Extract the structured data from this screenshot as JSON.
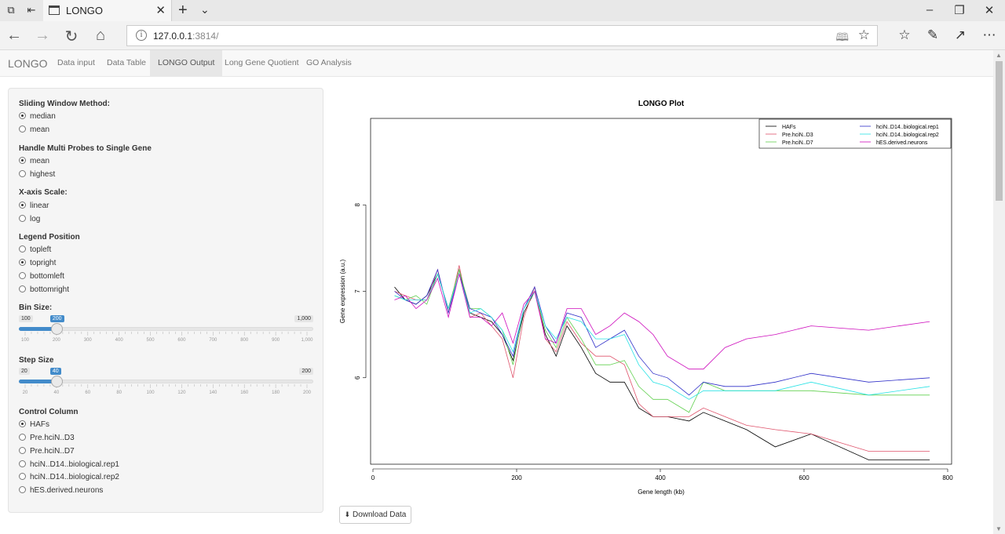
{
  "browser": {
    "tab_title": "LONGO",
    "url_host": "127.0.0.1",
    "url_rest": ":3814/"
  },
  "app": {
    "brand": "LONGO",
    "tabs": [
      "Data input",
      "Data Table",
      "LONGO Output",
      "Long Gene Quotient",
      "GO Analysis"
    ],
    "active_tab": "LONGO Output"
  },
  "sidebar": {
    "sliding_window": {
      "label": "Sliding Window Method:",
      "options": [
        "median",
        "mean"
      ],
      "selected": "median"
    },
    "multi_probes": {
      "label": "Handle Multi Probes to Single Gene",
      "options": [
        "mean",
        "highest"
      ],
      "selected": "mean"
    },
    "x_scale": {
      "label": "X-axis Scale:",
      "options": [
        "linear",
        "log"
      ],
      "selected": "linear"
    },
    "legend_position": {
      "label": "Legend Position",
      "options": [
        "topleft",
        "topright",
        "bottomleft",
        "bottomright"
      ],
      "selected": "topright"
    },
    "bin_size": {
      "label": "Bin Size:",
      "min": 100,
      "max": 1000,
      "value": 200,
      "min_label": "100",
      "max_label": "1,000",
      "value_label": "200",
      "ticks": [
        "100",
        "200",
        "300",
        "400",
        "500",
        "600",
        "700",
        "800",
        "900",
        "1,000"
      ]
    },
    "step_size": {
      "label": "Step Size",
      "min": 20,
      "max": 200,
      "value": 40,
      "min_label": "20",
      "max_label": "200",
      "value_label": "40",
      "ticks": [
        "20",
        "40",
        "60",
        "80",
        "100",
        "120",
        "140",
        "160",
        "180",
        "200"
      ]
    },
    "control_column": {
      "label": "Control Column",
      "options": [
        "HAFs",
        "Pre.hciN..D3",
        "Pre.hciN..D7",
        "hciN..D14..biological.rep1",
        "hciN..D14..biological.rep2",
        "hES.derived.neurons"
      ],
      "selected": "HAFs"
    }
  },
  "download_button": "Download Data",
  "chart_data": {
    "type": "line",
    "title": "LONGO Plot",
    "xlabel": "Gene length (kb)",
    "ylabel": "Gene expression (a.u.)",
    "xlim": [
      0,
      800
    ],
    "ylim": [
      5.0,
      9.0
    ],
    "xticks": [
      "0",
      "200",
      "400",
      "600",
      "800"
    ],
    "yticks": [
      "6",
      "7",
      "8"
    ],
    "legend_position": "top-right",
    "x": [
      30,
      45,
      60,
      75,
      90,
      105,
      120,
      135,
      150,
      165,
      180,
      195,
      210,
      225,
      240,
      255,
      270,
      290,
      310,
      330,
      350,
      370,
      390,
      410,
      440,
      460,
      490,
      520,
      560,
      610,
      690,
      775
    ],
    "series": [
      {
        "name": "HAFs",
        "color": "#000000",
        "values": [
          7.05,
          6.9,
          6.85,
          6.95,
          7.2,
          6.8,
          7.25,
          6.75,
          6.7,
          6.65,
          6.5,
          6.2,
          6.75,
          7.0,
          6.5,
          6.25,
          6.6,
          6.35,
          6.05,
          5.95,
          5.95,
          5.65,
          5.55,
          5.55,
          5.5,
          5.6,
          5.5,
          5.4,
          5.2,
          5.35,
          5.05,
          5.05
        ]
      },
      {
        "name": "Pre.hciN..D3",
        "color": "#df536b",
        "values": [
          7.0,
          6.95,
          6.9,
          6.9,
          7.25,
          6.75,
          7.3,
          6.7,
          6.75,
          6.6,
          6.45,
          6.0,
          6.7,
          7.05,
          6.45,
          6.3,
          6.65,
          6.4,
          6.25,
          6.25,
          6.15,
          5.7,
          5.55,
          5.55,
          5.55,
          5.65,
          5.55,
          5.45,
          5.4,
          5.35,
          5.15,
          5.15
        ]
      },
      {
        "name": "Pre.hciN..D7",
        "color": "#61d04f",
        "values": [
          6.95,
          6.9,
          6.95,
          6.85,
          7.2,
          6.8,
          7.25,
          6.8,
          6.8,
          6.7,
          6.55,
          6.15,
          6.8,
          7.0,
          6.55,
          6.35,
          6.7,
          6.45,
          6.15,
          6.15,
          6.2,
          5.9,
          5.75,
          5.75,
          5.6,
          5.95,
          5.85,
          5.85,
          5.85,
          5.85,
          5.8,
          5.8
        ]
      },
      {
        "name": "hciN..D14..biological.rep1",
        "color": "#2e2ec8",
        "values": [
          7.0,
          6.9,
          6.85,
          6.95,
          7.25,
          6.75,
          7.2,
          6.8,
          6.75,
          6.7,
          6.5,
          6.25,
          6.8,
          7.05,
          6.6,
          6.4,
          6.75,
          6.7,
          6.35,
          6.45,
          6.55,
          6.25,
          6.05,
          6.0,
          5.8,
          5.95,
          5.9,
          5.9,
          5.95,
          6.05,
          5.95,
          6.0
        ]
      },
      {
        "name": "hciN..D14..biological.rep2",
        "color": "#28e2e5",
        "values": [
          6.95,
          6.9,
          6.9,
          6.9,
          7.2,
          6.8,
          7.2,
          6.75,
          6.8,
          6.7,
          6.55,
          6.3,
          6.8,
          7.0,
          6.6,
          6.45,
          6.7,
          6.65,
          6.45,
          6.45,
          6.5,
          6.15,
          5.95,
          5.9,
          5.75,
          5.85,
          5.85,
          5.85,
          5.85,
          5.95,
          5.8,
          5.9
        ]
      },
      {
        "name": "hES.derived.neurons",
        "color": "#cd0bbc",
        "values": [
          6.9,
          6.95,
          6.8,
          6.9,
          7.15,
          6.7,
          7.2,
          6.7,
          6.7,
          6.6,
          6.75,
          6.4,
          6.85,
          7.0,
          6.45,
          6.4,
          6.8,
          6.8,
          6.5,
          6.6,
          6.75,
          6.65,
          6.5,
          6.25,
          6.1,
          6.1,
          6.35,
          6.45,
          6.5,
          6.6,
          6.55,
          6.65
        ]
      }
    ]
  }
}
